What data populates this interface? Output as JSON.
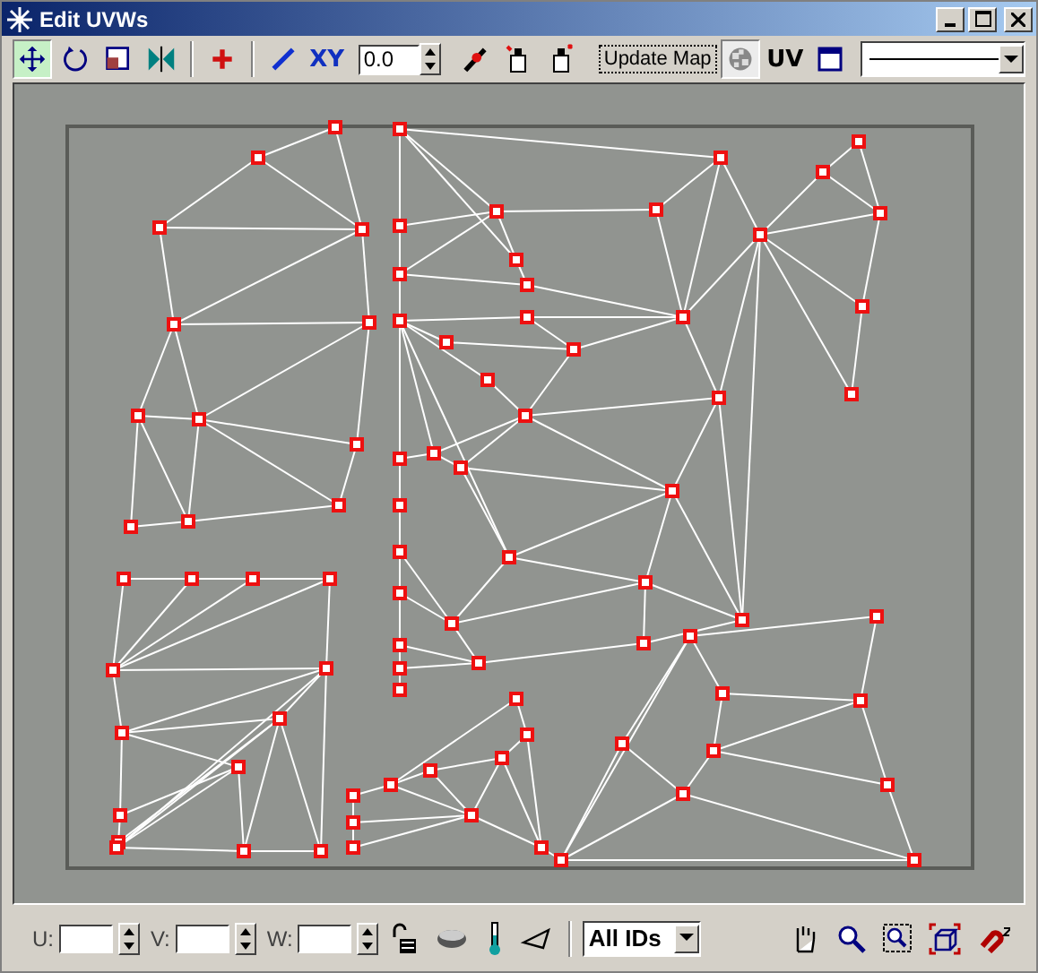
{
  "window": {
    "title": "Edit UVWs"
  },
  "toolbar": {
    "transform_tools": [
      {
        "kind": "move",
        "selected": true
      },
      {
        "kind": "rotate",
        "selected": false
      },
      {
        "kind": "scale",
        "selected": false
      },
      {
        "kind": "mirror",
        "selected": false
      }
    ],
    "xy_label": "XY",
    "offset_value": "0.0",
    "update_button": "Update Map",
    "checker_on": true,
    "uv_label": "UV"
  },
  "bottom_bar": {
    "fields": [
      {
        "label": "U:"
      },
      {
        "label": "V:"
      },
      {
        "label": "W:"
      }
    ],
    "id_filter": "All IDs"
  }
}
